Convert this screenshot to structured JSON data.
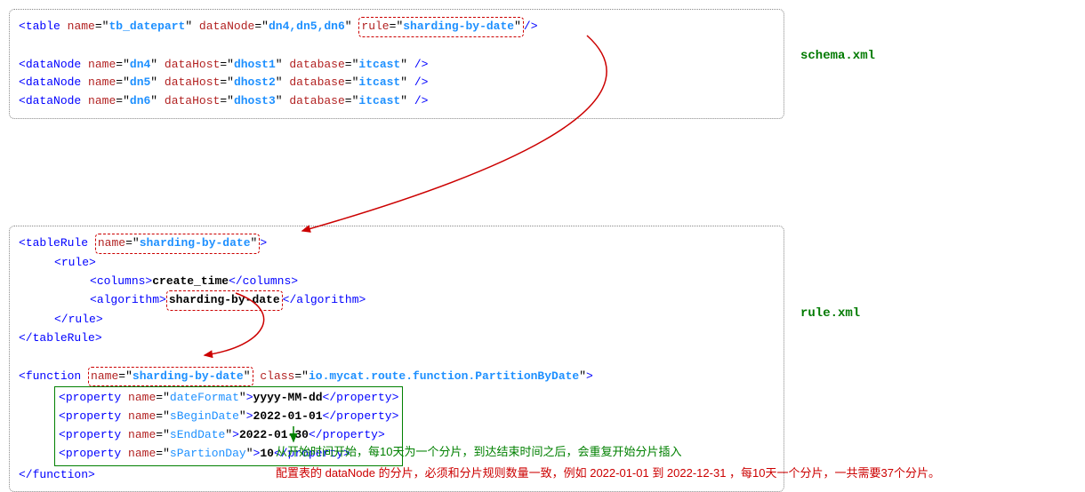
{
  "labels": {
    "schema": "schema.xml",
    "rule": "rule.xml"
  },
  "schema": {
    "table_tag": "table",
    "name_attr": "name",
    "table_name": "tb_datepart",
    "dataNode_attr": "dataNode",
    "dataNode_val": "dn4,dn5,dn6",
    "rule_attr": "rule",
    "rule_val": "sharding-by-date",
    "dn_tag": "dataNode",
    "dh_attr": "dataHost",
    "db_attr": "database",
    "db_val": "itcast",
    "nodes": [
      {
        "name": "dn4",
        "host": "dhost1"
      },
      {
        "name": "dn5",
        "host": "dhost2"
      },
      {
        "name": "dn6",
        "host": "dhost3"
      }
    ]
  },
  "rule": {
    "tableRule_tag": "tableRule",
    "name_attr": "name",
    "tableRule_name": "sharding-by-date",
    "rule_tag": "rule",
    "columns_tag": "columns",
    "columns_val": "create_time",
    "algorithm_tag": "algorithm",
    "algorithm_val": "sharding-by-date",
    "function_tag": "function",
    "function_name": "sharding-by-date",
    "class_attr": "class",
    "class_val": "io.mycat.route.function.PartitionByDate",
    "property_tag": "property",
    "props": [
      {
        "name": "dateFormat",
        "val": "yyyy-MM-dd"
      },
      {
        "name": "sBeginDate",
        "val": "2022-01-01"
      },
      {
        "name": "sEndDate",
        "val": "2022-01-30"
      },
      {
        "name": "sPartionDay",
        "val": "10"
      }
    ]
  },
  "notes": {
    "line1": "从开始时间开始，每10天为一个分片，到达结束时间之后，会重复开始分片插入",
    "line2": "配置表的 dataNode 的分片，必须和分片规则数量一致，例如 2022-01-01 到 2022-12-31 ，每10天一个分片，一共需要37个分片。"
  }
}
